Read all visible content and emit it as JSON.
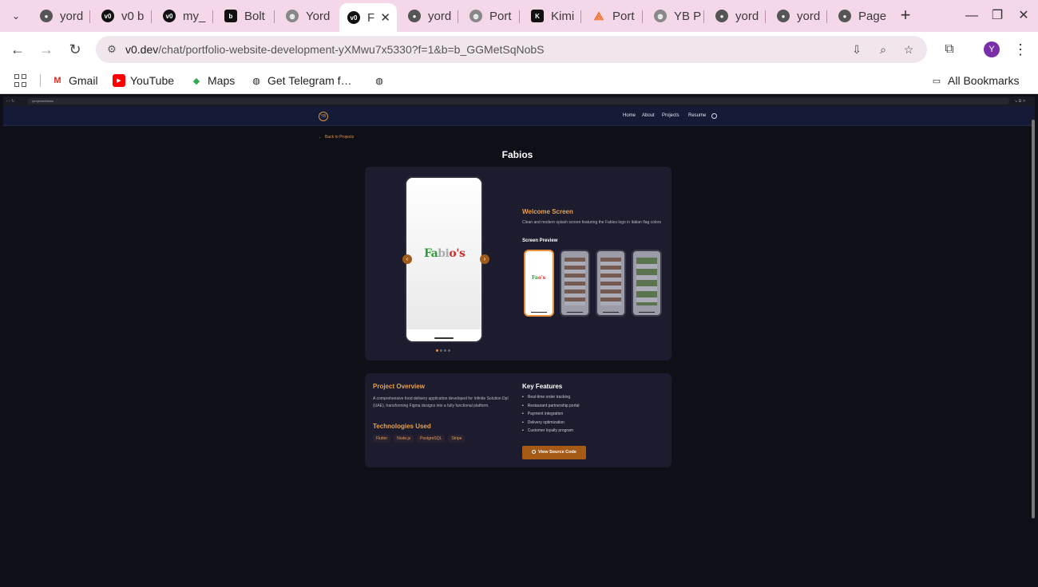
{
  "browser": {
    "tabs": [
      {
        "label": "yord",
        "icon": "github-icon"
      },
      {
        "label": "v0 b",
        "icon": "v0-icon"
      },
      {
        "label": "my_",
        "icon": "v0-icon"
      },
      {
        "label": "Bolt",
        "icon": "bolt-icon"
      },
      {
        "label": "Yord",
        "icon": "globe-icon"
      },
      {
        "label": "F",
        "icon": "v0-icon",
        "active": true
      },
      {
        "label": "yord",
        "icon": "github-icon"
      },
      {
        "label": "Port",
        "icon": "globe-icon"
      },
      {
        "label": "Kimi",
        "icon": "kimi-icon"
      },
      {
        "label": "Port",
        "icon": "portfolio-icon"
      },
      {
        "label": "YB P",
        "icon": "globe-icon"
      },
      {
        "label": "yord",
        "icon": "github-icon"
      },
      {
        "label": "yord",
        "icon": "github-icon"
      },
      {
        "label": "Page",
        "icon": "github-icon"
      }
    ],
    "url_host": "v0.dev",
    "url_path": "/chat/portfolio-website-development-yXMwu7x5330?f=1&b=b_GGMetSqNobS",
    "profile_initial": "Y",
    "bookmarks": [
      {
        "label": "Gmail",
        "icon": "gmail-icon"
      },
      {
        "label": "YouTube",
        "icon": "youtube-icon"
      },
      {
        "label": "Maps",
        "icon": "maps-icon"
      },
      {
        "label": "Get Telegram f…",
        "icon": "globe-icon"
      },
      {
        "label": "",
        "icon": "globe-icon"
      }
    ],
    "all_bookmarks": "All Bookmarks"
  },
  "inner": {
    "url": "/projects/fabios"
  },
  "site": {
    "logo": "YB",
    "nav": [
      "Home",
      "About",
      "Projects",
      "Resume"
    ],
    "back": "Back to Projects",
    "title": "Fabios",
    "screen": {
      "title": "Welcome Screen",
      "description": "Clean and modern splash screen featuring the Fabios logo in Italian flag colors",
      "preview_label": "Screen Preview"
    },
    "logo_text": {
      "p1": "Fa",
      "p2": "b",
      "p3": "i",
      "p4": "o's"
    },
    "overview": {
      "title": "Project Overview",
      "description": "A comprehensive food delivery application developed for Infinite Solution Dpl (UAE), transforming Figma designs into a fully functional platform."
    },
    "tech": {
      "title": "Technologies Used",
      "items": [
        "Flutter",
        "Node.js",
        "PostgreSQL",
        "Stripe"
      ]
    },
    "features": {
      "title": "Key Features",
      "items": [
        "Real-time order tracking",
        "Restaurant partnership portal",
        "Payment integration",
        "Delivery optimization",
        "Customer loyalty program"
      ]
    },
    "source_button": "View Source Code"
  }
}
